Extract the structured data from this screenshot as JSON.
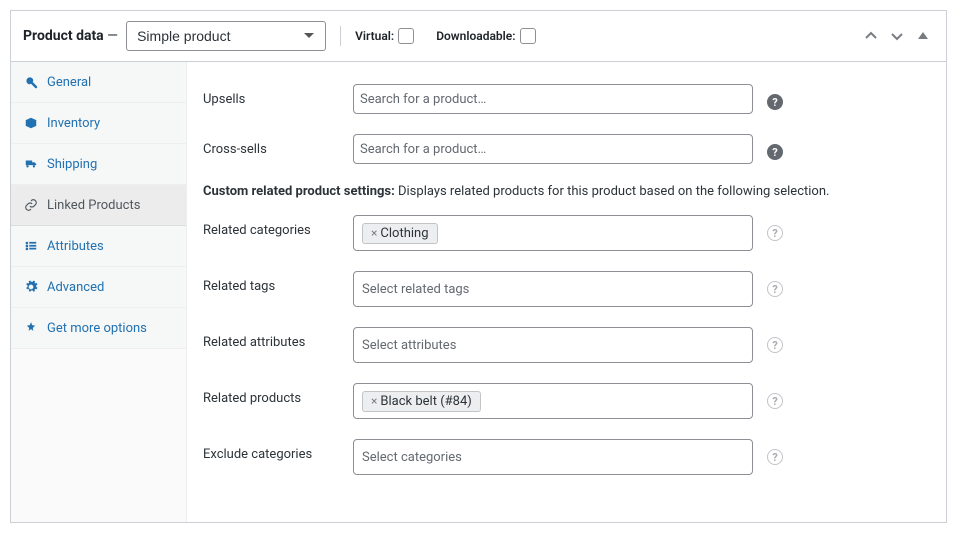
{
  "header": {
    "title_prefix": "Product data",
    "dash": " — ",
    "product_type": "Simple product",
    "virtual_label": "Virtual:",
    "downloadable_label": "Downloadable:"
  },
  "tabs": [
    {
      "key": "general",
      "label": "General",
      "icon": "wrench-icon"
    },
    {
      "key": "inventory",
      "label": "Inventory",
      "icon": "box-icon"
    },
    {
      "key": "shipping",
      "label": "Shipping",
      "icon": "truck-icon"
    },
    {
      "key": "linked",
      "label": "Linked Products",
      "icon": "link-icon",
      "active": true
    },
    {
      "key": "attributes",
      "label": "Attributes",
      "icon": "list-icon"
    },
    {
      "key": "advanced",
      "label": "Advanced",
      "icon": "gear-icon"
    },
    {
      "key": "more",
      "label": "Get more options",
      "icon": "addon-icon"
    }
  ],
  "content": {
    "upsells_label": "Upsells",
    "crosssells_label": "Cross-sells",
    "search_placeholder": "Search for a product…",
    "custom_heading_bold": "Custom related product settings:",
    "custom_heading_text": " Displays related products for this product based on the following selection.",
    "related_categories_label": "Related categories",
    "related_categories_tags": [
      "Clothing"
    ],
    "related_tags_label": "Related tags",
    "related_tags_placeholder": "Select related tags",
    "related_attributes_label": "Related attributes",
    "related_attributes_placeholder": "Select attributes",
    "related_products_label": "Related products",
    "related_products_tags": [
      "Black belt (#84)"
    ],
    "exclude_categories_label": "Exclude categories",
    "exclude_categories_placeholder": "Select categories"
  }
}
